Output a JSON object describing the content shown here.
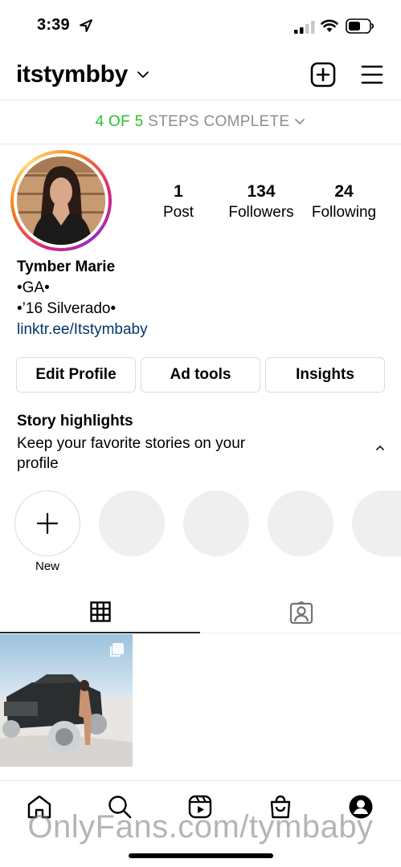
{
  "status_bar": {
    "time": "3:39",
    "icons": [
      "location-arrow-icon",
      "cellular-signal-icon",
      "wifi-icon",
      "battery-icon"
    ]
  },
  "header": {
    "username": "itstymbby",
    "icons": [
      "chevron-down-icon",
      "new-post-icon",
      "hamburger-menu-icon"
    ]
  },
  "steps": {
    "done": "4 OF 5",
    "rest": "STEPS COMPLETE"
  },
  "profile": {
    "stats": {
      "posts_count": "1",
      "posts_label": "Post",
      "followers_count": "134",
      "followers_label": "Followers",
      "following_count": "24",
      "following_label": "Following"
    },
    "name": "Tymber Marie",
    "bio_line1": "•GA•",
    "bio_line2": "•’16 Silverado•",
    "link": "linktr.ee/Itstymbaby"
  },
  "buttons": {
    "edit_profile": "Edit Profile",
    "ad_tools": "Ad tools",
    "insights": "Insights"
  },
  "highlights": {
    "title": "Story highlights",
    "description": "Keep your favorite stories on your profile",
    "new_label": "New",
    "empty_count": 4
  },
  "tabs": {
    "icons": [
      "grid-icon",
      "tagged-icon"
    ],
    "active": "grid"
  },
  "bottom_nav": {
    "icons": [
      "home-icon",
      "search-icon",
      "reels-icon",
      "shop-icon",
      "profile-icon"
    ]
  },
  "watermark": "OnlyFans.com/tymbaby",
  "colors": {
    "steps_done": "#2ac12a",
    "link": "#00376b",
    "muted": "#8e8e8e",
    "border": "#dbdbdb",
    "highlight_placeholder": "#efefef"
  }
}
